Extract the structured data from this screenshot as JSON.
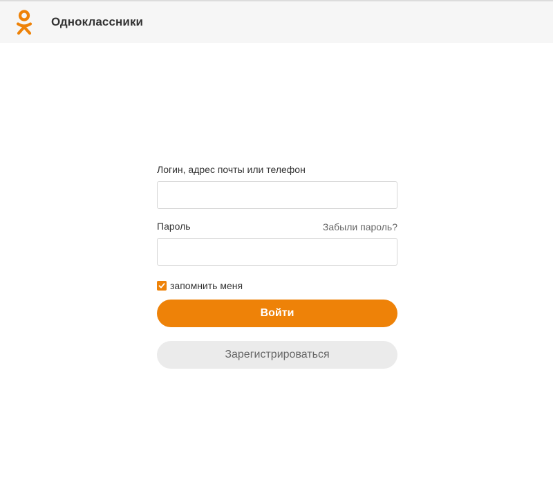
{
  "header": {
    "logo_icon": "odnoklassniki-logo-icon",
    "brand_name": "Одноклассники",
    "accent_color": "#ee8208"
  },
  "login_form": {
    "login_label": "Логин, адрес почты или телефон",
    "login_value": "",
    "password_label": "Пароль",
    "password_value": "",
    "forgot_password_link": "Забыли пароль?",
    "remember_me_label": "запомнить меня",
    "remember_me_checked": true,
    "login_button": "Войти",
    "register_button": "Зарегистрироваться"
  }
}
